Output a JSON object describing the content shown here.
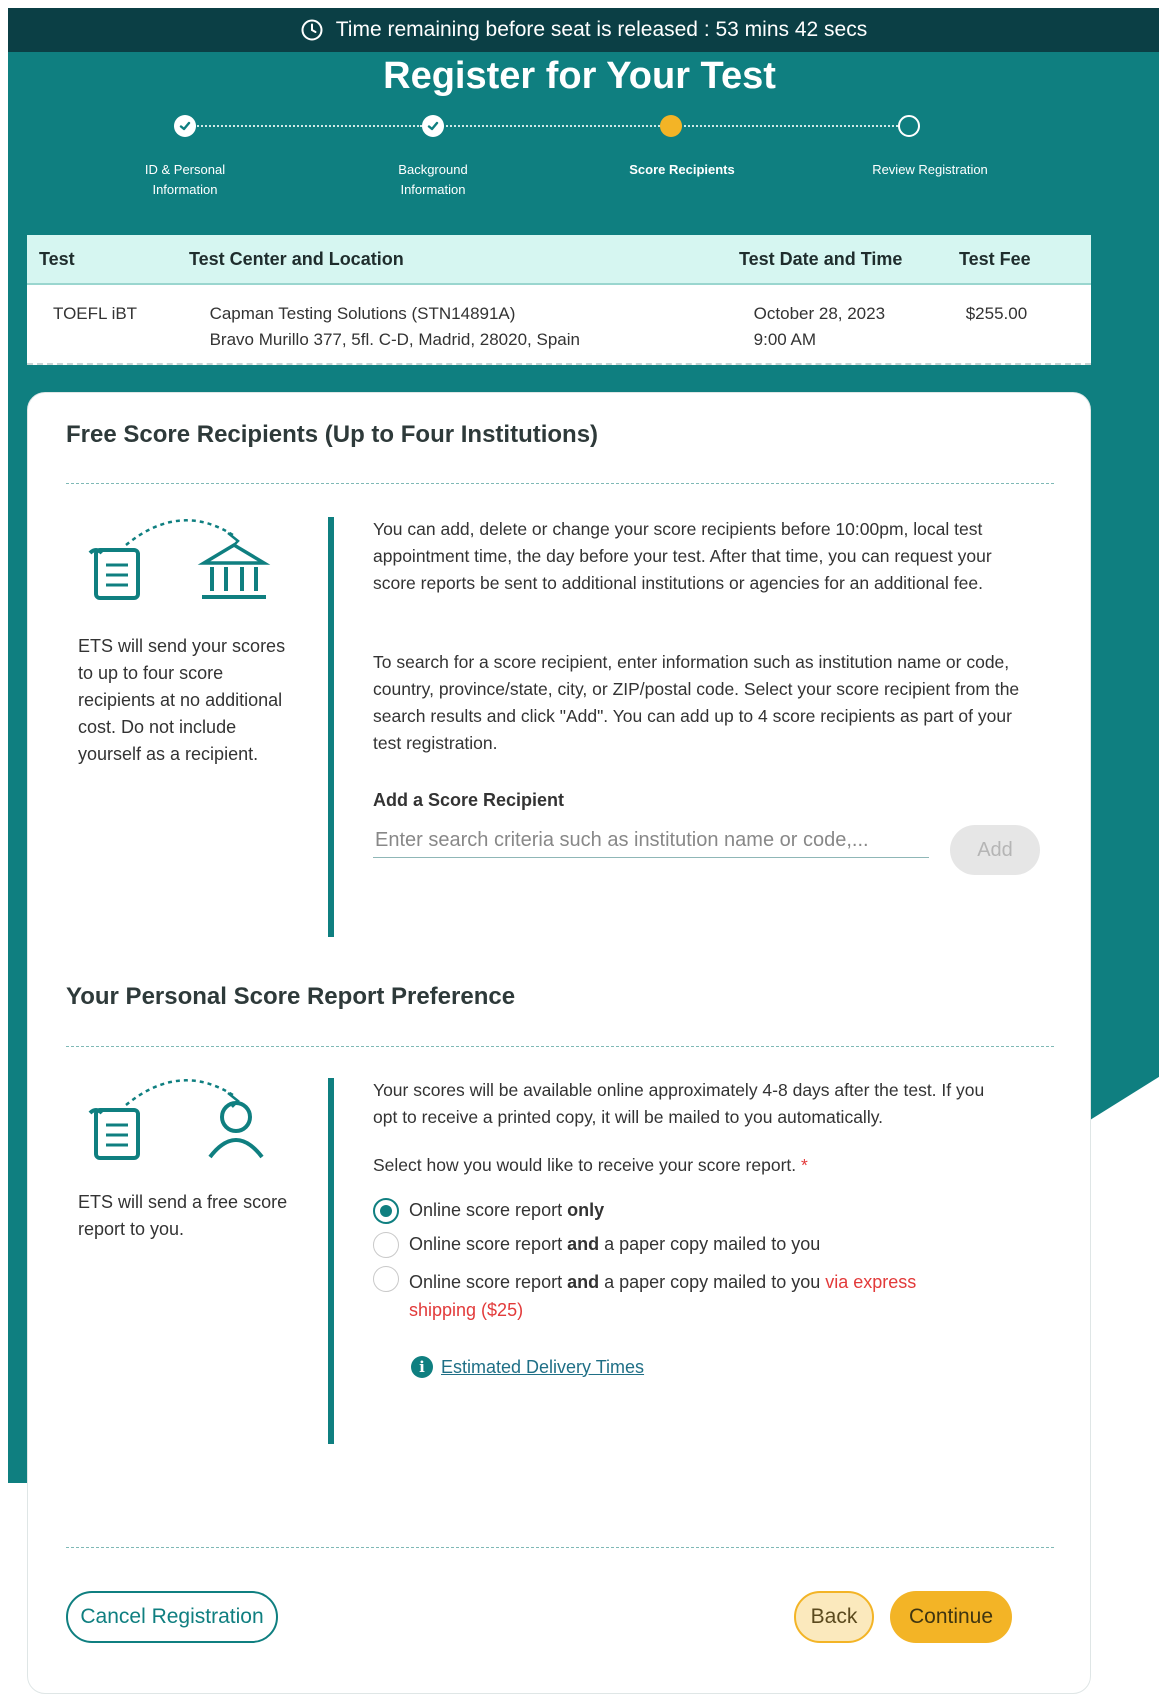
{
  "timer": {
    "text": "Time remaining before seat is released : 53 mins 42 secs"
  },
  "page_title": "Register for Your Test",
  "stepper": {
    "steps": [
      {
        "label_line1": "ID & Personal",
        "label_line2": "Information",
        "state": "done"
      },
      {
        "label_line1": "Background",
        "label_line2": "Information",
        "state": "done"
      },
      {
        "label_line1": "Score Recipients",
        "label_line2": "",
        "state": "current"
      },
      {
        "label_line1": "Review Registration",
        "label_line2": "",
        "state": "todo"
      }
    ]
  },
  "test_table": {
    "headers": [
      "Test",
      "Test Center and Location",
      "Test Date and Time",
      "Test Fee"
    ],
    "row": {
      "test": "TOEFL iBT",
      "center_line1": "Capman Testing Solutions (STN14891A)",
      "center_line2": "Bravo Murillo 377, 5fl. C-D,  Madrid,  28020,  Spain",
      "date_line1": "October 28, 2023",
      "date_line2": "9:00 AM",
      "fee": "$255.00"
    }
  },
  "free_recipients": {
    "title": "Free Score Recipients (Up to Four Institutions)",
    "side_text": "ETS will send your scores to up to four score recipients at no additional cost. Do not include yourself as a recipient.",
    "paragraph1": "You can add, delete or change your score recipients before 10:00pm, local test appointment time, the day before your test. After that time, you can request your score reports be sent to additional institutions or agencies for an additional fee.",
    "paragraph2": "To search for a score recipient, enter information such as institution name or code, country, province/state, city, or ZIP/postal code. Select your score recipient from the search results and click \"Add\". You can add up to 4 score recipients as part of your test registration.",
    "add_label": "Add a Score Recipient",
    "search_placeholder": "Enter search criteria such as institution name or code,...",
    "add_button": "Add"
  },
  "personal_report": {
    "title": "Your Personal Score Report Preference",
    "side_text": "ETS will send a free score report to you.",
    "paragraph": "Your scores will be available online approximately 4-8 days after the test. If you opt to receive a printed copy, it will be mailed to you automatically.",
    "select_label": "Select how you would like to receive your score report.",
    "required_mark": "*",
    "options": [
      {
        "pre": "Online score report ",
        "bold": "only",
        "post": "",
        "extra": "",
        "selected": true
      },
      {
        "pre": "Online score report ",
        "bold": "and",
        "post": " a paper copy mailed to you",
        "extra": "",
        "selected": false
      },
      {
        "pre": "Online score report ",
        "bold": "and",
        "post": " a paper copy mailed to you ",
        "extra": "via express shipping ($25)",
        "selected": false
      }
    ],
    "delivery_link": "Estimated Delivery Times"
  },
  "footer": {
    "cancel": "Cancel Registration",
    "back": "Back",
    "continue": "Continue"
  },
  "colors": {
    "teal": "#0f7f80",
    "dark_bar": "#0b3f45",
    "accent": "#f3b426",
    "express_red": "#e23a3a"
  }
}
